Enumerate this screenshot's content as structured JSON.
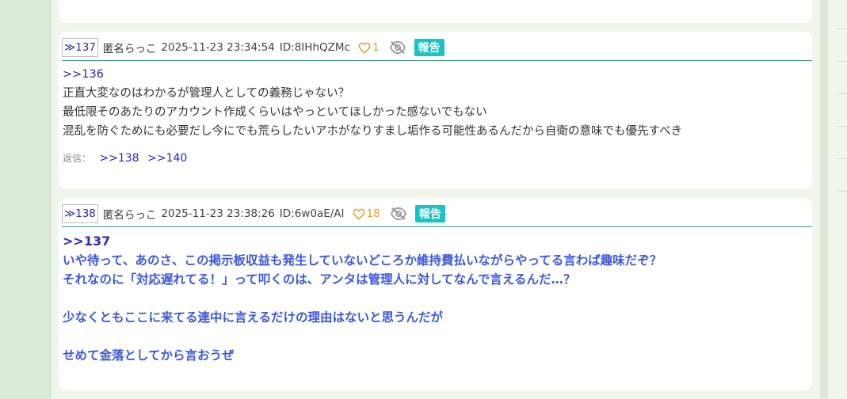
{
  "posts": [
    {
      "number": "≫137",
      "name": "匿名らっこ",
      "date": "2025-11-23 23:34:54",
      "id": "ID:8IHhQZMc",
      "likes": "1",
      "report": "報告",
      "reply_to": ">>136",
      "lines": [
        "正直大変なのはわかるが管理人としての義務じゃない？",
        "最低限そのあたりのアカウント作成くらいはやっといてほしかった感ないでもない",
        "混乱を防ぐためにも必要だし今にでも荒らしたいアホがなりすまし垢作る可能性あるんだから自衛の意味でも優先すべき"
      ],
      "replies_label": "返信：",
      "replies": [
        ">>138",
        ">>140"
      ]
    },
    {
      "number": "≫138",
      "name": "匿名らっこ",
      "date": "2025-11-23 23:38:26",
      "id": "ID:6w0aE/AI",
      "likes": "18",
      "report": "報告",
      "reply_to": ">>137",
      "lines": [
        "いや待って、あのさ、この掲示板収益も発生していないどころか維持費払いながらやってる言わば趣味だぞ？",
        "それなのに「対応遅れてる！」って叩くのは、アンタは管理人に対してなんで言えるんだ…？",
        "",
        "少なくともここに来てる連中に言えるだけの理由はないと思うんだが",
        "",
        "せめて金落としてから言おうぜ"
      ]
    }
  ]
}
